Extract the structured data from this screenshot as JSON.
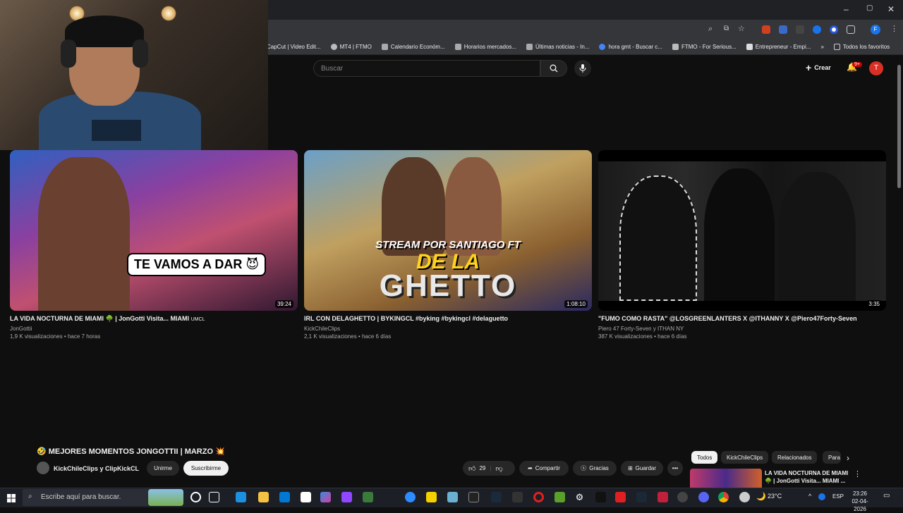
{
  "browser": {
    "bookmarks": [
      {
        "label": "CapCut | Video Edit...",
        "color": "#ffffff"
      },
      {
        "label": "MT4 | FTMO",
        "color": "#bbbbbb"
      },
      {
        "label": "Calendario Económ...",
        "color": "#aaaaaa"
      },
      {
        "label": "Horarios mercados...",
        "color": "#aaaaaa"
      },
      {
        "label": "Últimas noticias - In...",
        "color": "#aaaaaa"
      },
      {
        "label": "hora gmt - Buscar c...",
        "color": "#4285f4"
      },
      {
        "label": "FTMO - For Serious...",
        "color": "#bbbbbb"
      },
      {
        "label": "Entrepreneur - Empi...",
        "color": "#dddddd"
      }
    ],
    "bookmarks_more": "»",
    "all_favorites": "Todos los favoritos",
    "profile_initial": "F",
    "window_controls": [
      "–",
      "▢",
      "✕"
    ]
  },
  "youtube": {
    "search_placeholder": "Buscar",
    "create_label": "Crear",
    "notif_badge": "9+",
    "avatar_initial": "T"
  },
  "videos": [
    {
      "title": "LA VIDA NOCTURNA DE MIAMI 🌳 | JonGotti Visita... MIAMI",
      "tag": "UMCL",
      "channel": "JonGottii",
      "meta": "1,9 K visualizaciones • hace 7 horas",
      "duration": "39:24",
      "thumb_text": "TE VAMOS A DAR 😈"
    },
    {
      "title": "IRL CON DELAGHETTO | BYKINGCL #byking #bykingcl #delaguetto",
      "channel": "KickChileClips",
      "meta": "2,1 K visualizaciones • hace 6 días",
      "duration": "1:08:10",
      "thumb_text_1": "STREAM POR SANTIAGO FT",
      "thumb_text_2": "DE LA",
      "thumb_text_3": "GHETTO"
    },
    {
      "title": "\"FUMO COMO RASTA\" @LOSGREENLANTERS X @ITHANNY X @Piero47Forty-Seven",
      "channel": "Piero 47 Forty-Seven y ITHAN NY",
      "meta": "387 K visualizaciones • hace 6 días",
      "duration": "3:35"
    }
  ],
  "watch": {
    "title": "🤣 MEJORES MOMENTOS JONGOTTII | MARZO 💥",
    "channel": "KickChileClips y ClipKickCL",
    "join": "Unirme",
    "subscribe": "Suscribirme",
    "likes": "29",
    "share": "Compartir",
    "thanks": "Gracias",
    "save": "Guardar",
    "more": "•••"
  },
  "sidebar_chips": [
    "Todos",
    "KickChileClips",
    "Relacionados",
    "Para"
  ],
  "related": {
    "title": "LA VIDA NOCTURNA DE MIAMI 🌳 | JonGotti Visita... MIAMI ..."
  },
  "taskbar": {
    "search_placeholder": "Escribe aquí para buscar.",
    "weather": "23°C",
    "lang": "ESP",
    "time": "23:26",
    "date": "02-04-2026"
  }
}
